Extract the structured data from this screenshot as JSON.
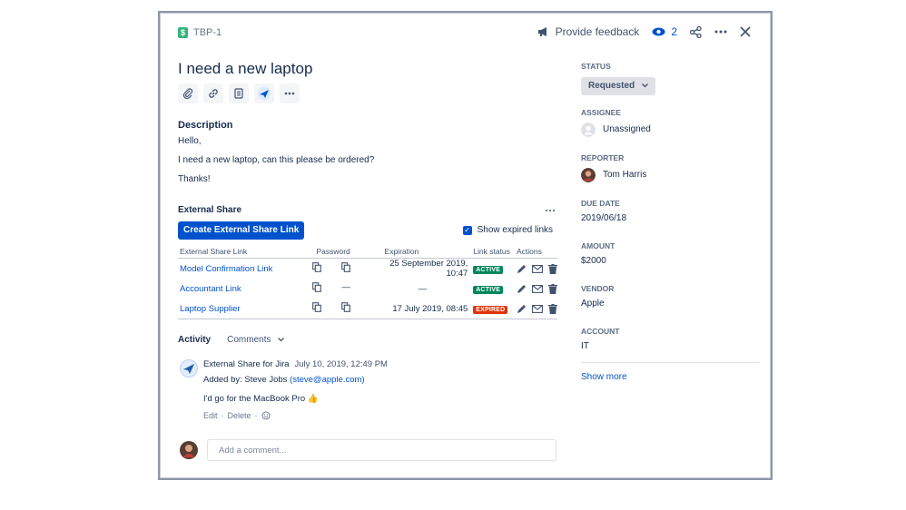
{
  "issue": {
    "key": "TBP-1",
    "title": "I need a new laptop"
  },
  "topbar": {
    "feedback_label": "Provide feedback",
    "watch_count": "2"
  },
  "description": {
    "heading": "Description",
    "lines": [
      "Hello,",
      "I need a new laptop, can this please be ordered?",
      "Thanks!"
    ]
  },
  "external_share": {
    "heading": "External Share",
    "create_button": "Create External Share Link",
    "show_expired_label": "Show expired links",
    "columns": [
      "External Share Link",
      "Password",
      "Expiration",
      "Link status",
      "Actions"
    ],
    "rows": [
      {
        "name": "Model Confirmation Link",
        "expiration": "25 September 2019, 10:47",
        "status": "ACTIVE",
        "password_set": true
      },
      {
        "name": "Accountant Link",
        "expiration": "—",
        "status": "ACTIVE",
        "password_set": false
      },
      {
        "name": "Laptop Supplier",
        "expiration": "17 July 2019, 08:45",
        "status": "EXPIRED",
        "password_set": true
      }
    ],
    "no_password": "—",
    "colors": {
      "active": "#00875a",
      "expired": "#de350b"
    }
  },
  "activity": {
    "heading": "Activity",
    "filter": "Comments",
    "comment": {
      "author": "External Share for Jira",
      "timestamp": "July 10, 2019, 12:49 PM",
      "added_by_prefix": "Added by: Steve Jobs",
      "added_by_email": "(steve@apple.com)",
      "text": "I'd go for the MacBook Pro",
      "emoji": "👍",
      "edit": "Edit",
      "delete": "Delete"
    },
    "add_comment_placeholder": "Add a comment..."
  },
  "sidebar": {
    "status_label": "STATUS",
    "status_value": "Requested",
    "assignee_label": "ASSIGNEE",
    "assignee_value": "Unassigned",
    "reporter_label": "REPORTER",
    "reporter_value": "Tom Harris",
    "due_label": "DUE DATE",
    "due_value": "2019/06/18",
    "amount_label": "AMOUNT",
    "amount_value": "$2000",
    "vendor_label": "VENDOR",
    "vendor_value": "Apple",
    "account_label": "ACCOUNT",
    "account_value": "IT",
    "show_more": "Show more"
  }
}
